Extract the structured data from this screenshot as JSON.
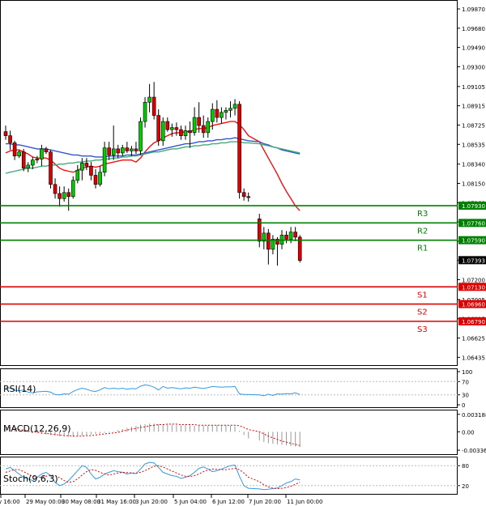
{
  "chart_data": {
    "type": "candlestick",
    "price_axis": {
      "ticks": [
        1.0987,
        1.0968,
        1.0949,
        1.093,
        1.09105,
        1.08915,
        1.08725,
        1.08535,
        1.0834,
        1.0815,
        1.0796,
        1.0777,
        1.0758,
        1.07393,
        1.072,
        1.07005,
        1.06815,
        1.06625,
        1.06435
      ],
      "tick_labels": [
        "1.09870",
        "1.09680",
        "1.09490",
        "1.09300",
        "1.09105",
        "1.08915",
        "1.08725",
        "1.08535",
        "1.08340",
        "1.08150",
        "1.07960",
        "1.07770",
        "1.07580",
        "1.07393",
        "1.07200",
        "1.07005",
        "1.06815",
        "1.06625",
        "1.06435"
      ],
      "range": [
        1.0635,
        1.0995
      ]
    },
    "time_axis": {
      "labels": [
        "29 May 00:00",
        "30 May 08:00",
        "31 May 16:00",
        "3 Jun 20:00",
        "5 Jun 04:00",
        "6 Jun 12:00",
        "7 Jun 20:00",
        "11 Jun 00:00"
      ],
      "first_label_partial": "y 16:00"
    },
    "levels": [
      {
        "name": "R3",
        "value": 1.0793,
        "label": "1.07930",
        "color": "#008000"
      },
      {
        "name": "R2",
        "value": 1.0776,
        "label": "1.07760",
        "color": "#008000"
      },
      {
        "name": "R1",
        "value": 1.0759,
        "label": "1.07590",
        "color": "#008000"
      },
      {
        "name": "S1",
        "value": 1.0713,
        "label": "1.07130",
        "color": "#dd0000"
      },
      {
        "name": "S2",
        "value": 1.0696,
        "label": "1.06960",
        "color": "#dd0000"
      },
      {
        "name": "S3",
        "value": 1.0679,
        "label": "1.06790",
        "color": "#dd0000"
      }
    ],
    "current_price": {
      "value": 1.07393,
      "label": "1.07393"
    },
    "candles": [
      {
        "o": 1.0866,
        "h": 1.0872,
        "l": 1.0858,
        "c": 1.0862
      },
      {
        "o": 1.0862,
        "h": 1.0867,
        "l": 1.0848,
        "c": 1.0855
      },
      {
        "o": 1.0855,
        "h": 1.0857,
        "l": 1.0838,
        "c": 1.0842
      },
      {
        "o": 1.0842,
        "h": 1.0848,
        "l": 1.084,
        "c": 1.0846
      },
      {
        "o": 1.0846,
        "h": 1.0849,
        "l": 1.0827,
        "c": 1.083
      },
      {
        "o": 1.083,
        "h": 1.0836,
        "l": 1.0826,
        "c": 1.0833
      },
      {
        "o": 1.0833,
        "h": 1.0841,
        "l": 1.0829,
        "c": 1.0838
      },
      {
        "o": 1.0838,
        "h": 1.0842,
        "l": 1.0835,
        "c": 1.0839
      },
      {
        "o": 1.0839,
        "h": 1.0853,
        "l": 1.0832,
        "c": 1.0849
      },
      {
        "o": 1.0849,
        "h": 1.0851,
        "l": 1.0844,
        "c": 1.0846
      },
      {
        "o": 1.0846,
        "h": 1.0848,
        "l": 1.081,
        "c": 1.0814
      },
      {
        "o": 1.0814,
        "h": 1.082,
        "l": 1.08,
        "c": 1.0805
      },
      {
        "o": 1.0805,
        "h": 1.0812,
        "l": 1.0792,
        "c": 1.08
      },
      {
        "o": 1.08,
        "h": 1.0812,
        "l": 1.0797,
        "c": 1.0806
      },
      {
        "o": 1.0806,
        "h": 1.081,
        "l": 1.0788,
        "c": 1.0802
      },
      {
        "o": 1.0802,
        "h": 1.0822,
        "l": 1.08,
        "c": 1.0818
      },
      {
        "o": 1.0818,
        "h": 1.0833,
        "l": 1.0815,
        "c": 1.0828
      },
      {
        "o": 1.0828,
        "h": 1.084,
        "l": 1.0818,
        "c": 1.0835
      },
      {
        "o": 1.0835,
        "h": 1.084,
        "l": 1.0828,
        "c": 1.0832
      },
      {
        "o": 1.0832,
        "h": 1.0836,
        "l": 1.0818,
        "c": 1.0823
      },
      {
        "o": 1.0823,
        "h": 1.0829,
        "l": 1.081,
        "c": 1.0814
      },
      {
        "o": 1.0814,
        "h": 1.0832,
        "l": 1.0812,
        "c": 1.0826
      },
      {
        "o": 1.0826,
        "h": 1.0856,
        "l": 1.0822,
        "c": 1.085
      },
      {
        "o": 1.085,
        "h": 1.0856,
        "l": 1.0838,
        "c": 1.0843
      },
      {
        "o": 1.0843,
        "h": 1.0872,
        "l": 1.0838,
        "c": 1.0849
      },
      {
        "o": 1.0849,
        "h": 1.0853,
        "l": 1.084,
        "c": 1.0845
      },
      {
        "o": 1.0845,
        "h": 1.0853,
        "l": 1.0842,
        "c": 1.085
      },
      {
        "o": 1.085,
        "h": 1.0856,
        "l": 1.0845,
        "c": 1.0847
      },
      {
        "o": 1.0847,
        "h": 1.0852,
        "l": 1.0842,
        "c": 1.0849
      },
      {
        "o": 1.0849,
        "h": 1.0856,
        "l": 1.0844,
        "c": 1.0847
      },
      {
        "o": 1.0847,
        "h": 1.088,
        "l": 1.0843,
        "c": 1.0876
      },
      {
        "o": 1.0876,
        "h": 1.09,
        "l": 1.087,
        "c": 1.0895
      },
      {
        "o": 1.0895,
        "h": 1.0913,
        "l": 1.0885,
        "c": 1.09
      },
      {
        "o": 1.09,
        "h": 1.0915,
        "l": 1.0878,
        "c": 1.0882
      },
      {
        "o": 1.0882,
        "h": 1.0888,
        "l": 1.0852,
        "c": 1.0857
      },
      {
        "o": 1.0857,
        "h": 1.088,
        "l": 1.0852,
        "c": 1.0876
      },
      {
        "o": 1.0876,
        "h": 1.088,
        "l": 1.0866,
        "c": 1.0868
      },
      {
        "o": 1.0868,
        "h": 1.0874,
        "l": 1.0861,
        "c": 1.087
      },
      {
        "o": 1.087,
        "h": 1.0875,
        "l": 1.0862,
        "c": 1.0868
      },
      {
        "o": 1.0868,
        "h": 1.0872,
        "l": 1.0858,
        "c": 1.0862
      },
      {
        "o": 1.0862,
        "h": 1.0872,
        "l": 1.0858,
        "c": 1.0867
      },
      {
        "o": 1.0867,
        "h": 1.0876,
        "l": 1.085,
        "c": 1.0865
      },
      {
        "o": 1.0865,
        "h": 1.089,
        "l": 1.0862,
        "c": 1.088
      },
      {
        "o": 1.088,
        "h": 1.0895,
        "l": 1.0865,
        "c": 1.0872
      },
      {
        "o": 1.0872,
        "h": 1.0882,
        "l": 1.086,
        "c": 1.0865
      },
      {
        "o": 1.0865,
        "h": 1.088,
        "l": 1.086,
        "c": 1.0876
      },
      {
        "o": 1.0876,
        "h": 1.0894,
        "l": 1.0868,
        "c": 1.0888
      },
      {
        "o": 1.0888,
        "h": 1.0897,
        "l": 1.0875,
        "c": 1.088
      },
      {
        "o": 1.088,
        "h": 1.089,
        "l": 1.0874,
        "c": 1.0885
      },
      {
        "o": 1.0885,
        "h": 1.089,
        "l": 1.0878,
        "c": 1.0887
      },
      {
        "o": 1.0887,
        "h": 1.0896,
        "l": 1.088,
        "c": 1.0889
      },
      {
        "o": 1.0889,
        "h": 1.0898,
        "l": 1.0882,
        "c": 1.0893
      },
      {
        "o": 1.0893,
        "h": 1.0896,
        "l": 1.08,
        "c": 1.0806
      },
      {
        "o": 1.0806,
        "h": 1.081,
        "l": 1.0798,
        "c": 1.0802
      },
      {
        "o": 1.0802,
        "h": 1.0806,
        "l": 1.0797,
        "c": 1.0801
      },
      {
        "o": 1.078,
        "h": 1.0785,
        "l": 1.0752,
        "c": 1.0758
      },
      {
        "o": 1.0758,
        "h": 1.0772,
        "l": 1.075,
        "c": 1.0766
      },
      {
        "o": 1.0766,
        "h": 1.077,
        "l": 1.0735,
        "c": 1.075
      },
      {
        "o": 1.075,
        "h": 1.0764,
        "l": 1.0745,
        "c": 1.076
      },
      {
        "o": 1.076,
        "h": 1.0762,
        "l": 1.0734,
        "c": 1.0755
      },
      {
        "o": 1.0755,
        "h": 1.0769,
        "l": 1.075,
        "c": 1.0764
      },
      {
        "o": 1.0764,
        "h": 1.0768,
        "l": 1.0756,
        "c": 1.076
      },
      {
        "o": 1.076,
        "h": 1.0772,
        "l": 1.0756,
        "c": 1.0767
      },
      {
        "o": 1.0767,
        "h": 1.0772,
        "l": 1.0758,
        "c": 1.0762
      },
      {
        "o": 1.0762,
        "h": 1.0764,
        "l": 1.0737,
        "c": 1.0739
      }
    ],
    "moving_averages": [
      {
        "name": "fast",
        "color": "#ee1111",
        "values": [
          1.0845,
          1.0847,
          1.0848,
          1.0848,
          1.0846,
          1.0844,
          1.0841,
          1.084,
          1.084,
          1.084,
          1.0838,
          1.0834,
          1.083,
          1.0828,
          1.0827,
          1.0826,
          1.0828,
          1.083,
          1.0831,
          1.0832,
          1.0831,
          1.0832,
          1.0834,
          1.0835,
          1.0836,
          1.0837,
          1.0838,
          1.0838,
          1.0838,
          1.0836,
          1.084,
          1.0846,
          1.0851,
          1.0855,
          1.0857,
          1.086,
          1.0862,
          1.0864,
          1.0865,
          1.0865,
          1.0866,
          1.0866,
          1.0868,
          1.0869,
          1.0869,
          1.087,
          1.0872,
          1.0873,
          1.0874,
          1.0875,
          1.0876,
          1.0876,
          1.0873,
          1.0868,
          1.0862,
          1.0856,
          1.0848,
          1.084,
          1.0832,
          1.0824,
          1.0815,
          1.0807,
          1.08,
          1.0793,
          1.0788
        ]
      },
      {
        "name": "medium",
        "color": "#3355cc",
        "values": [
          1.0854,
          1.0854,
          1.0853,
          1.0853,
          1.0852,
          1.0851,
          1.085,
          1.0849,
          1.0849,
          1.0849,
          1.0848,
          1.0847,
          1.0846,
          1.0845,
          1.0844,
          1.0843,
          1.0843,
          1.0842,
          1.0842,
          1.0842,
          1.0841,
          1.0841,
          1.0841,
          1.0842,
          1.0842,
          1.0842,
          1.0842,
          1.0843,
          1.0843,
          1.0843,
          1.0844,
          1.0845,
          1.0846,
          1.0847,
          1.0848,
          1.0849,
          1.085,
          1.0851,
          1.0852,
          1.0853,
          1.0854,
          1.0854,
          1.0855,
          1.0856,
          1.0856,
          1.0857,
          1.0857,
          1.0858,
          1.0858,
          1.0859,
          1.0859,
          1.086,
          1.0859,
          1.0858,
          1.0857,
          1.0856,
          1.0854,
          1.0853,
          1.0851,
          1.085,
          1.0848,
          1.0847,
          1.0846,
          1.0845,
          1.0844
        ]
      },
      {
        "name": "slow",
        "color": "#44aa77",
        "values": [
          1.0825,
          1.0826,
          1.0827,
          1.0828,
          1.0829,
          1.083,
          1.083,
          1.0831,
          1.0832,
          1.0832,
          1.0833,
          1.0833,
          1.0834,
          1.0834,
          1.0835,
          1.0835,
          1.0836,
          1.0836,
          1.0837,
          1.0837,
          1.0838,
          1.0838,
          1.0839,
          1.0839,
          1.084,
          1.084,
          1.0841,
          1.0841,
          1.0842,
          1.0842,
          1.0843,
          1.0844,
          1.0845,
          1.0846,
          1.0846,
          1.0847,
          1.0848,
          1.0849,
          1.0849,
          1.085,
          1.0851,
          1.0851,
          1.0852,
          1.0852,
          1.0853,
          1.0853,
          1.0854,
          1.0854,
          1.0855,
          1.0855,
          1.0856,
          1.0856,
          1.0856,
          1.0855,
          1.0855,
          1.0854,
          1.0853,
          1.0852,
          1.0851,
          1.085,
          1.0849,
          1.0848,
          1.0847,
          1.0846,
          1.0845
        ]
      }
    ],
    "indicators": [
      {
        "name": "RSI(14)",
        "ticks": [
          100,
          70,
          30,
          0
        ],
        "tick_labels": [
          "100",
          "70",
          "30",
          "0"
        ],
        "range": [
          0,
          100
        ],
        "color": "#3399dd",
        "values": [
          52,
          50,
          44,
          42,
          45,
          38,
          36,
          39,
          40,
          41,
          38,
          31,
          30,
          33,
          32,
          40,
          46,
          50,
          47,
          42,
          40,
          45,
          52,
          48,
          50,
          48,
          50,
          47,
          49,
          48,
          56,
          60,
          58,
          53,
          45,
          55,
          50,
          52,
          50,
          48,
          51,
          50,
          53,
          51,
          49,
          52,
          55,
          54,
          53,
          54,
          54,
          55,
          33,
          31,
          31,
          30,
          27,
          32,
          28,
          33,
          32,
          34,
          33,
          36,
          31
        ]
      },
      {
        "name": "MACD(12,26,9)",
        "ticks": [
          0.003188,
          0.0,
          -0.003368
        ],
        "tick_labels": [
          "0.003188",
          "0.00",
          "-0.003368"
        ],
        "range": [
          -0.0038,
          0.0036
        ],
        "histogram_color": "#999999",
        "signal_color": "#dd0000",
        "histogram": [
          0.0006,
          0.0005,
          0.0004,
          0.0002,
          0.0001,
          -0.0001,
          -0.0002,
          -0.0003,
          -0.0004,
          -0.0005,
          -0.0006,
          -0.0007,
          -0.0008,
          -0.0008,
          -0.0009,
          -0.0009,
          -0.0008,
          -0.0007,
          -0.0006,
          -0.0005,
          -0.0004,
          -0.0003,
          -0.0002,
          -0.0001,
          0.0001,
          0.0003,
          0.0005,
          0.0007,
          0.0009,
          0.0011,
          0.0013,
          0.0014,
          0.0015,
          0.0015,
          0.0014,
          0.0014,
          0.0013,
          0.0013,
          0.0012,
          0.0012,
          0.0012,
          0.0012,
          0.0011,
          0.0011,
          0.0011,
          0.0011,
          0.0012,
          0.0012,
          0.0012,
          0.0012,
          0.0011,
          0.001,
          0.0002,
          -0.0006,
          -0.0012,
          -0.0016,
          -0.0019,
          -0.0021,
          -0.0022,
          -0.0023,
          -0.0024,
          -0.0025,
          -0.0026,
          -0.0027,
          -0.0028
        ],
        "signal": [
          0.0008,
          0.0007,
          0.0006,
          0.0004,
          0.0003,
          0.0001,
          0.0,
          -0.0001,
          -0.0002,
          -0.0003,
          -0.0004,
          -0.0005,
          -0.0006,
          -0.0007,
          -0.0007,
          -0.0008,
          -0.0008,
          -0.0008,
          -0.0007,
          -0.0007,
          -0.0006,
          -0.0005,
          -0.0004,
          -0.0003,
          -0.0002,
          -0.0001,
          0.0001,
          0.0003,
          0.0005,
          0.0006,
          0.0008,
          0.0009,
          0.0011,
          0.0012,
          0.0013,
          0.0013,
          0.0014,
          0.0014,
          0.0014,
          0.0013,
          0.0013,
          0.0013,
          0.0013,
          0.0012,
          0.0012,
          0.0012,
          0.0012,
          0.0012,
          0.0012,
          0.0012,
          0.0012,
          0.0012,
          0.0011,
          0.0008,
          0.0004,
          0.0,
          -0.0004,
          -0.0008,
          -0.0011,
          -0.0014,
          -0.0017,
          -0.0019,
          -0.0021,
          -0.0023,
          -0.0025
        ]
      },
      {
        "name": "Stoch(9,6,3)",
        "ticks": [
          80,
          20
        ],
        "tick_labels": [
          "80",
          "20"
        ],
        "range": [
          0,
          100
        ],
        "main_color": "#3399dd",
        "signal_color": "#dd0000",
        "main": [
          70,
          75,
          65,
          55,
          45,
          40,
          35,
          45,
          55,
          60,
          50,
          30,
          20,
          25,
          35,
          50,
          65,
          80,
          75,
          55,
          40,
          45,
          55,
          60,
          65,
          62,
          60,
          55,
          58,
          56,
          70,
          85,
          90,
          88,
          75,
          60,
          55,
          50,
          48,
          42,
          45,
          50,
          60,
          72,
          76,
          70,
          62,
          65,
          70,
          75,
          80,
          82,
          48,
          20,
          12,
          10,
          8,
          9,
          11,
          13,
          20,
          28,
          32,
          40,
          37
        ],
        "signal": [
          60,
          64,
          68,
          68,
          62,
          55,
          48,
          45,
          45,
          48,
          52,
          50,
          44,
          35,
          30,
          32,
          40,
          52,
          62,
          68,
          66,
          60,
          55,
          52,
          55,
          58,
          60,
          59,
          58,
          57,
          60,
          65,
          72,
          78,
          80,
          76,
          70,
          64,
          58,
          52,
          48,
          47,
          50,
          55,
          62,
          67,
          70,
          69,
          68,
          68,
          70,
          72,
          68,
          58,
          45,
          32,
          22,
          16,
          12,
          11,
          12,
          14,
          18,
          24,
          30
        ]
      }
    ]
  }
}
